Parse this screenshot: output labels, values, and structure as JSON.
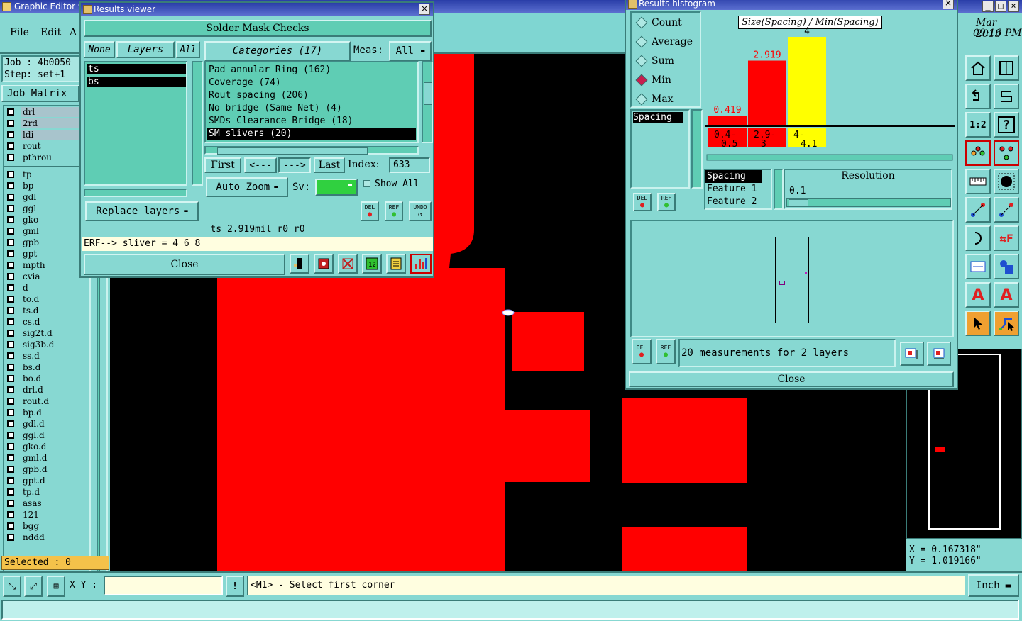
{
  "main_window": {
    "title": "Graphic Editor 9.",
    "menu": [
      "File",
      "Edit",
      "A"
    ],
    "job_label": "Job : 4b0050",
    "step_label": "Step: set+1",
    "job_matrix": "Job Matrix",
    "layers_top": [
      "drl",
      "2rd",
      "ldi",
      "rout",
      "pthrou"
    ],
    "layers": [
      "tp",
      "bp",
      "gdl",
      "ggl",
      "gko",
      "gml",
      "gpb",
      "gpt",
      "mpth",
      "cvia",
      "d",
      "to.d",
      "ts.d",
      "cs.d",
      "sig2t.d",
      "sig3b.d",
      "ss.d",
      "bs.d",
      "bo.d",
      "drl.d",
      "rout.d",
      "bp.d",
      "gdl.d",
      "ggl.d",
      "gko.d",
      "gml.d",
      "gpb.d",
      "gpt.d",
      "tp.d",
      "asas",
      "121",
      "bgg",
      "nddd"
    ],
    "selected": "Selected : 0",
    "xy_label": "X Y :",
    "xy_value": "",
    "status": "<M1> - Select first corner",
    "units": "Inch",
    "date": "Mar 2013",
    "time": "09:16 PM",
    "coord_x": "X = 0.167318\"",
    "coord_y": "Y = 1.019166\""
  },
  "results_viewer": {
    "title": "Results viewer",
    "header": "Solder Mask Checks",
    "none_btn": "None",
    "layers_btn": "Layers",
    "all_btn": "All",
    "categories_btn": "Categories (17)",
    "meas_label": "Meas:",
    "meas_value": "All",
    "layer_items": [
      "ts",
      "bs"
    ],
    "categories": [
      "Pad annular Ring (162)",
      "Coverage (74)",
      "Rout spacing (206)",
      "No bridge (Same Net) (4)",
      "SMDs Clearance Bridge (18)",
      "SM slivers (20)"
    ],
    "first": "First",
    "prev": "<---",
    "next": "--->",
    "last": "Last",
    "index_label": "Index:",
    "index_value": "633",
    "auto_zoom": "Auto Zoom",
    "sv_label": "Sv:",
    "show_all": "Show All",
    "replace_layers": "Replace layers",
    "del": "DEL",
    "ref": "REF",
    "undo": "UNDO",
    "info": "ts 2.919mil  r0  r0",
    "erf": "ERF--> sliver = 4 6 8",
    "close": "Close"
  },
  "histogram": {
    "title": "Results histogram",
    "modes": [
      "Count",
      "Average",
      "Sum",
      "Min",
      "Max"
    ],
    "selected_mode": "Min",
    "chart_title": "Size(Spacing) / Min(Spacing)",
    "bars": [
      {
        "label": "0.419",
        "range": "0.4-\n0.5",
        "value": 0.419,
        "color": "#ff0000"
      },
      {
        "label": "2.919",
        "range": "2.9-\n3",
        "value": 2.919,
        "color": "#ff0000"
      },
      {
        "label": "4",
        "range": "4-\n4.1",
        "value": 4,
        "color": "#ffff00"
      }
    ],
    "spacing_list": [
      "Spacing"
    ],
    "axis_list": [
      "Spacing",
      "Feature 1",
      "Feature 2"
    ],
    "resolution_label": "Resolution",
    "resolution_value": "0.1",
    "del": "DEL",
    "ref": "REF",
    "measurements": "20 measurements for 2 layers",
    "close": "Close"
  }
}
